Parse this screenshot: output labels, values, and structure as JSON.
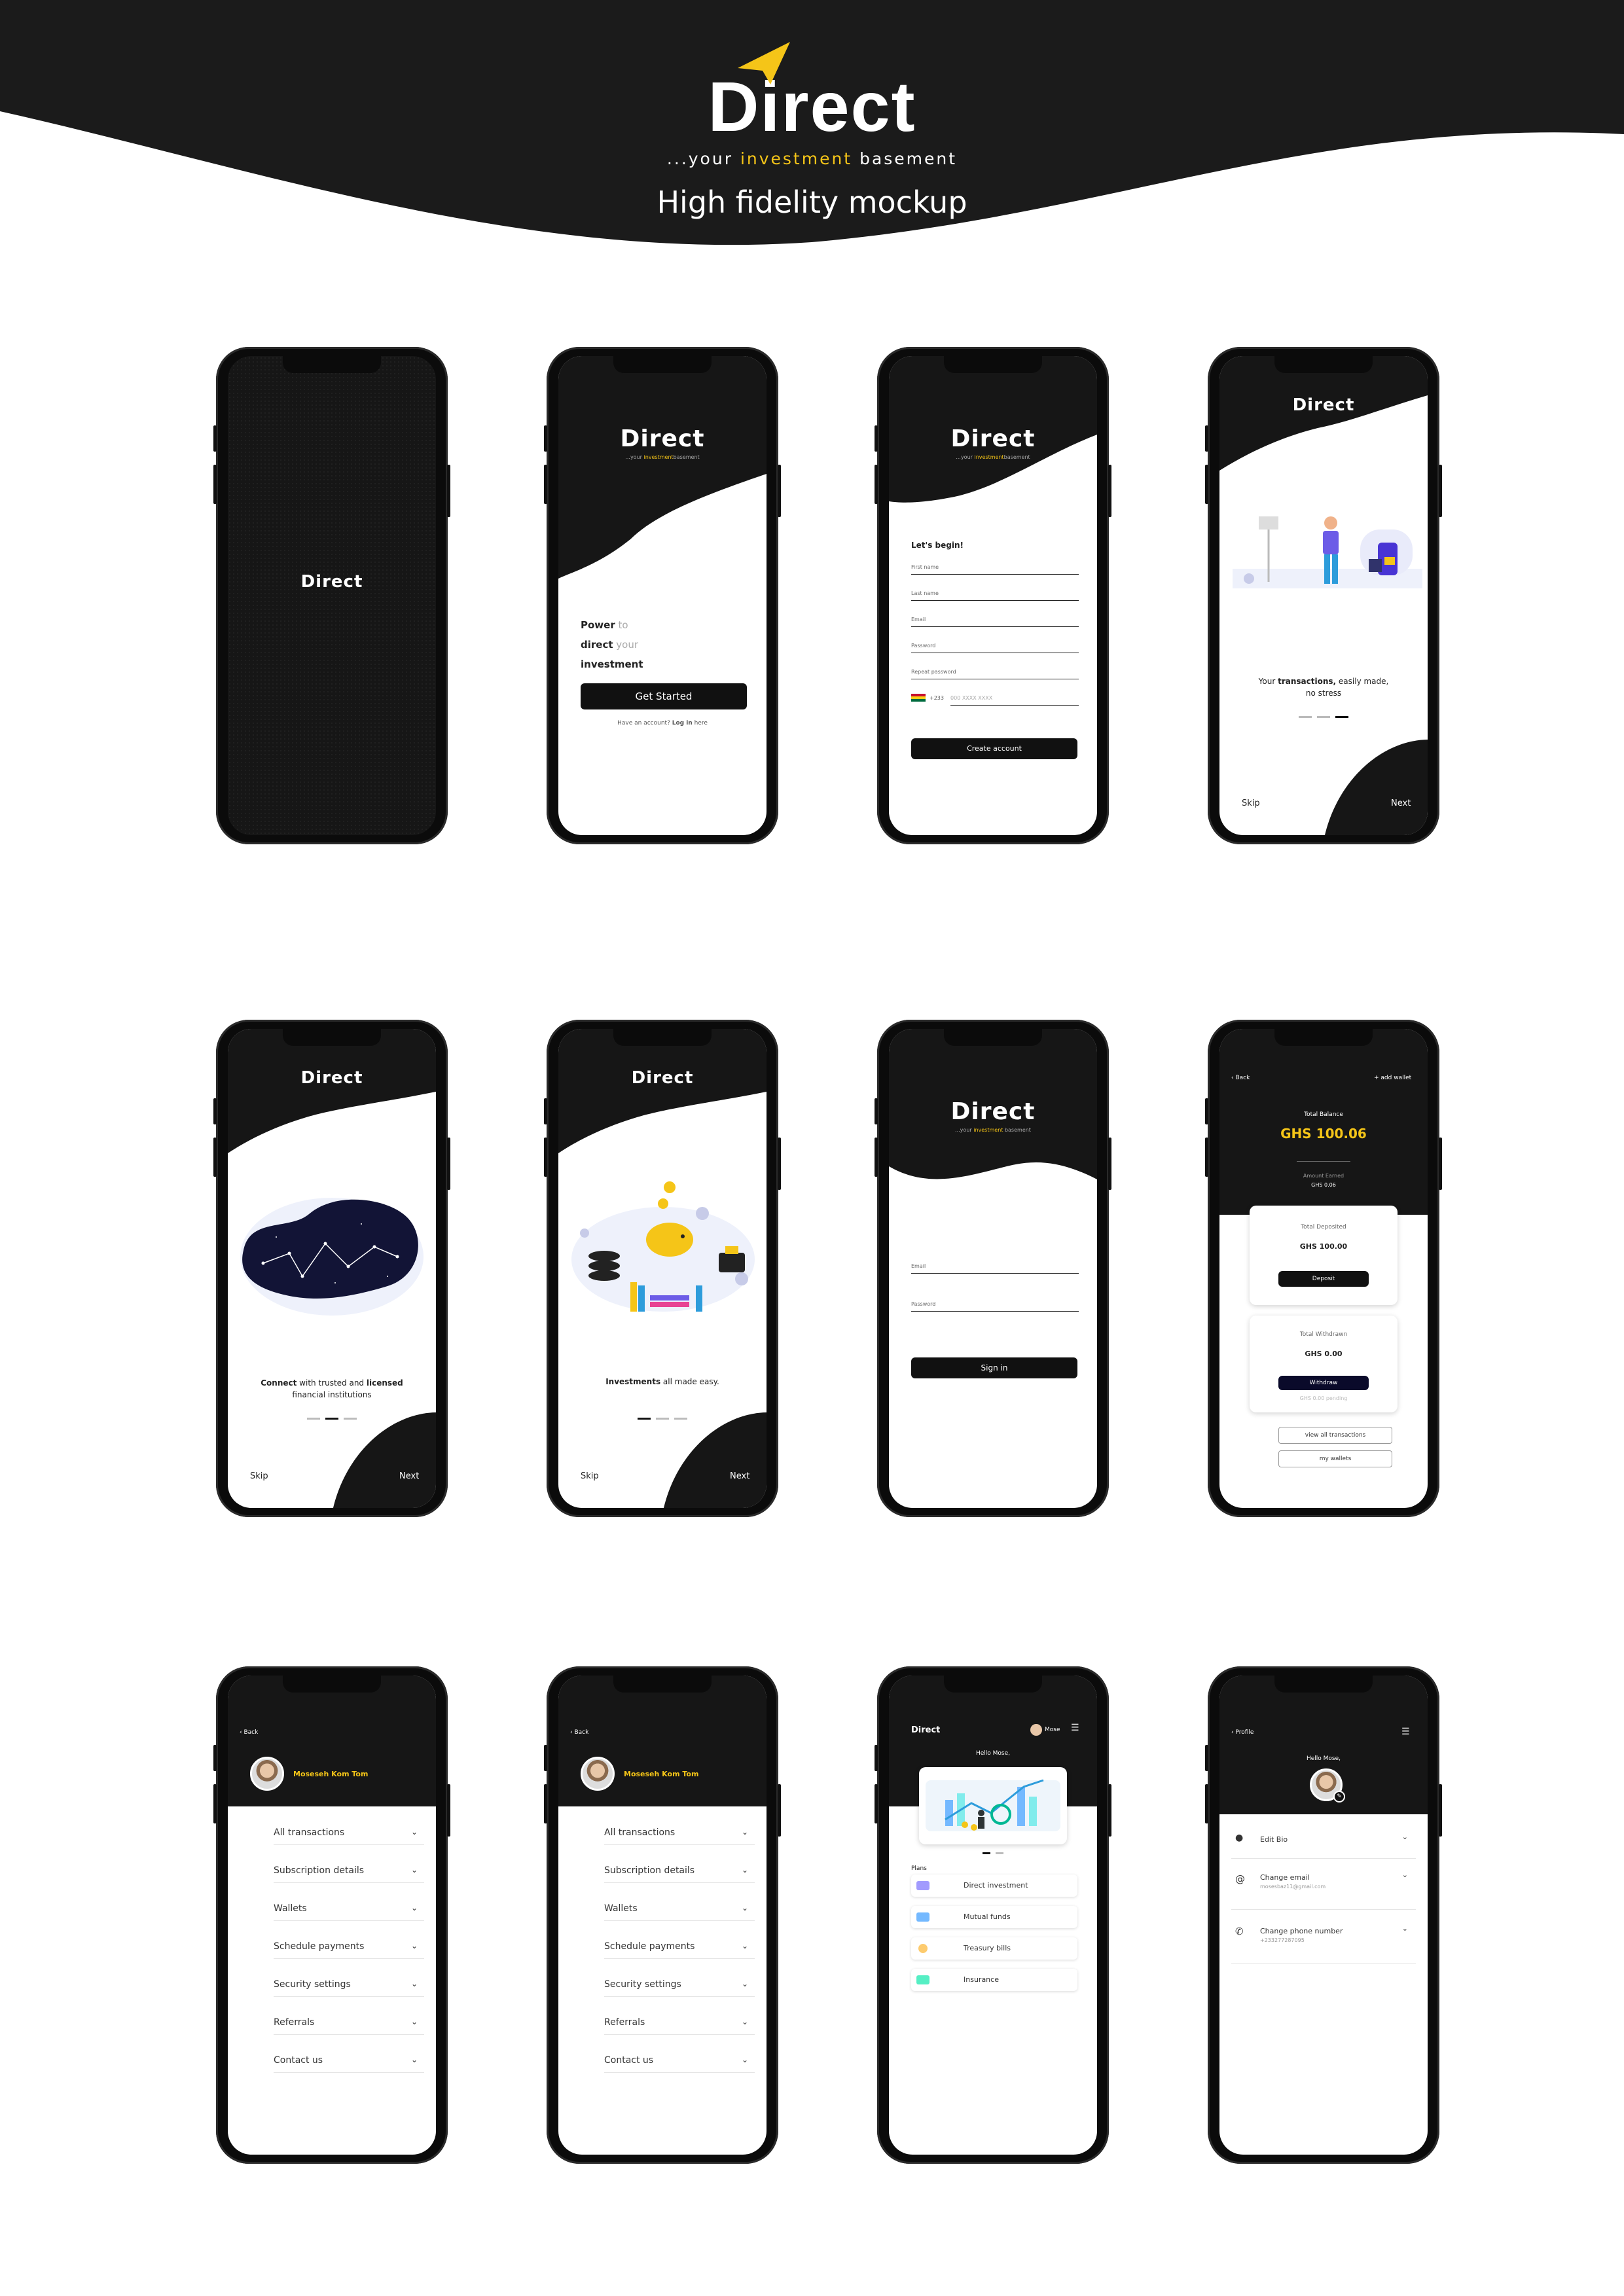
{
  "header": {
    "brand": "Direct",
    "tagline_pre": "...your ",
    "tagline_gold": "investment",
    "tagline_post": " basement",
    "title": "High fidelity mockup"
  },
  "colors": {
    "dark": "#111111",
    "gold": "#f5c518",
    "white": "#ffffff"
  },
  "screens": {
    "splash": {
      "brand": "Direct"
    },
    "welcome": {
      "brand": "Direct",
      "tag_pre": "...your ",
      "tag_gold": "investment",
      "tag_post": "basement",
      "line1_bold": "Power",
      "line1_light": " to",
      "line2_bold": "direct",
      "line2_light": " your",
      "line3_bold": "investment",
      "cta": "Get Started",
      "login_pre": "Have an account? ",
      "login_link": "Log in",
      "login_post": " here"
    },
    "signup": {
      "brand": "Direct",
      "tag_pre": "...your ",
      "tag_gold": "investment",
      "tag_post": "basement",
      "heading": "Let's begin!",
      "fields": [
        "First name",
        "Last name",
        "Email",
        "Password",
        "Repeat password"
      ],
      "phone_prefix": "+233",
      "phone_placeholder": "000 XXXX XXXX",
      "cta": "Create account"
    },
    "onboard1": {
      "brand": "Direct",
      "caption_pre": "Your ",
      "caption_bold": "transactions,",
      "caption_post": " easily made,",
      "caption_line2": "no stress",
      "skip": "Skip",
      "next": "Next"
    },
    "onboard2": {
      "brand": "Direct",
      "caption_b1": "Connect",
      "caption_m": " with trusted and ",
      "caption_b2": "licensed",
      "caption_line2": "financial institutions",
      "skip": "Skip",
      "next": "Next"
    },
    "onboard3": {
      "brand": "Direct",
      "caption_bold": "Investments",
      "caption_post": " all made easy.",
      "skip": "Skip",
      "next": "Next"
    },
    "signin": {
      "brand": "Direct",
      "tag_pre": "...your ",
      "tag_gold": "investment",
      "tag_post": " basement",
      "fields": [
        "Email",
        "Password"
      ],
      "cta": "Sign in"
    },
    "wallet": {
      "back": "‹  Back",
      "add": "+ add wallet",
      "balance_label": "Total  Balance",
      "balance": "GHS 100.06",
      "earned_label": "Amount Earned",
      "earned": "GHS 0.06",
      "dep_label": "Total Deposited",
      "dep_value": "GHS 100.00",
      "dep_btn": "Deposit",
      "wd_label": "Total Withdrawn",
      "wd_value": "GHS 0.00",
      "wd_btn": "Withdraw",
      "wd_pending": "GHS 0.00 pending",
      "btn_transactions": "view all transactions",
      "btn_wallets": "my wallets"
    },
    "menu": {
      "back": "‹  Back",
      "user": "Moseseh Kom Tom",
      "items": [
        "All transactions",
        "Subscription details",
        "Wallets",
        "Schedule payments",
        "Security settings",
        "Referrals",
        "Contact us"
      ]
    },
    "dashboard": {
      "brand": "Direct",
      "user_short": "Mose",
      "greeting": "Hello Mose,",
      "plans_label": "Plans",
      "plans": [
        "Direct investment",
        "Mutual funds",
        "Treasury bills",
        "Insurance"
      ]
    },
    "profile": {
      "back": "‹  Profile",
      "greeting": "Hello Mose,",
      "edit_bio": "Edit Bio",
      "email_label": "Change email",
      "email_value": "mosesbaz11@gmail.com",
      "phone_label": "Change phone number",
      "phone_value": "+233277287095"
    }
  }
}
